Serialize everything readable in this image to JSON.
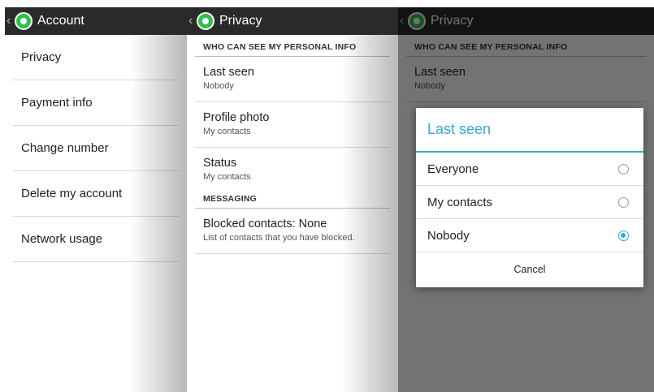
{
  "account_panel": {
    "title": "Account",
    "items": [
      {
        "label": "Privacy"
      },
      {
        "label": "Payment info"
      },
      {
        "label": "Change number"
      },
      {
        "label": "Delete my account"
      },
      {
        "label": "Network usage"
      }
    ]
  },
  "privacy_panel": {
    "title": "Privacy",
    "section_personal": "WHO CAN SEE MY PERSONAL INFO",
    "last_seen": {
      "title": "Last seen",
      "value": "Nobody"
    },
    "profile_photo": {
      "title": "Profile photo",
      "value": "My contacts"
    },
    "status": {
      "title": "Status",
      "value": "My contacts"
    },
    "section_messaging": "MESSAGING",
    "blocked": {
      "title": "Blocked contacts: None",
      "value": "List of contacts that you have blocked."
    }
  },
  "dialog_panel": {
    "title": "Privacy",
    "section_personal": "WHO CAN SEE MY PERSONAL INFO",
    "last_seen": {
      "title": "Last seen",
      "value": "Nobody"
    },
    "dialog": {
      "title": "Last seen",
      "options": [
        {
          "label": "Everyone",
          "selected": false
        },
        {
          "label": "My contacts",
          "selected": false
        },
        {
          "label": "Nobody",
          "selected": true
        }
      ],
      "cancel_label": "Cancel"
    }
  },
  "colors": {
    "accent": "#35a7cf",
    "actionbar": "#2a2a2a",
    "whatsapp_green": "#2fbf4a"
  }
}
